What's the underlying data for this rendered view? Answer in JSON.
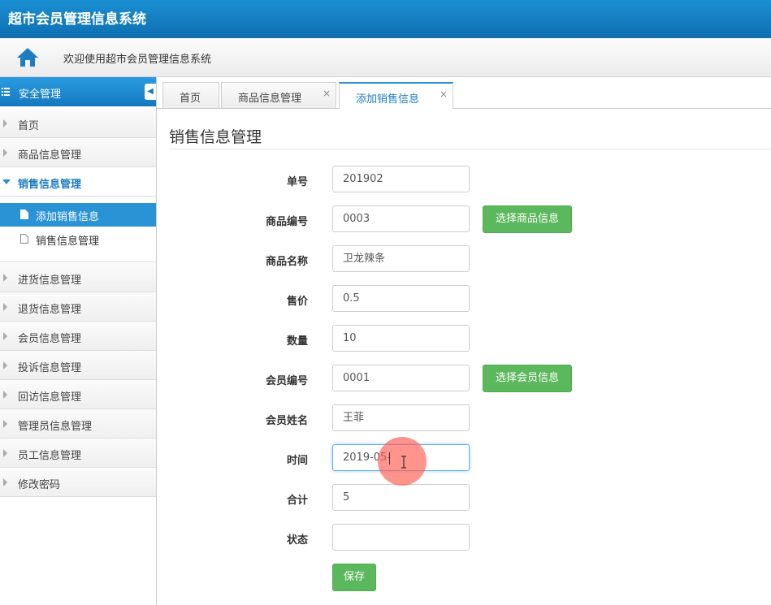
{
  "app": {
    "title": "超市会员管理信息系统"
  },
  "welcome": {
    "text": "欢迎使用超市会员管理信息系统",
    "icon": "home-icon"
  },
  "sidebar": {
    "header": "安全管理",
    "collapse_glyph": "◀",
    "items": [
      {
        "label": "首页"
      },
      {
        "label": "商品信息管理"
      },
      {
        "label": "销售信息管理",
        "expanded": true,
        "children": [
          {
            "label": "添加销售信息",
            "active": true
          },
          {
            "label": "销售信息管理"
          }
        ]
      },
      {
        "label": "进货信息管理"
      },
      {
        "label": "退货信息管理"
      },
      {
        "label": "会员信息管理"
      },
      {
        "label": "投诉信息管理"
      },
      {
        "label": "回访信息管理"
      },
      {
        "label": "管理员信息管理"
      },
      {
        "label": "员工信息管理"
      },
      {
        "label": "修改密码"
      }
    ]
  },
  "tabs": [
    {
      "label": "首页",
      "closable": false
    },
    {
      "label": "商品信息管理",
      "closable": true
    },
    {
      "label": "添加销售信息",
      "closable": true,
      "active": true
    }
  ],
  "tab_close_glyph": "×",
  "main": {
    "title": "销售信息管理",
    "fields": [
      {
        "label": "单号",
        "value": "201902"
      },
      {
        "label": "商品编号",
        "value": "0003",
        "button": "选择商品信息"
      },
      {
        "label": "商品名称",
        "value": "卫龙辣条"
      },
      {
        "label": "售价",
        "value": "0.5"
      },
      {
        "label": "数量",
        "value": "10"
      },
      {
        "label": "会员编号",
        "value": "0001",
        "button": "选择会员信息"
      },
      {
        "label": "会员姓名",
        "value": "王菲"
      },
      {
        "label": "时间",
        "value": "2019-05-",
        "focused": true
      },
      {
        "label": "合计",
        "value": "5"
      },
      {
        "label": "状态",
        "value": ""
      }
    ],
    "save_label": "保存"
  },
  "colors": {
    "brand": "#1478bf",
    "accent": "#2a93d5",
    "success": "#5cb85c"
  }
}
